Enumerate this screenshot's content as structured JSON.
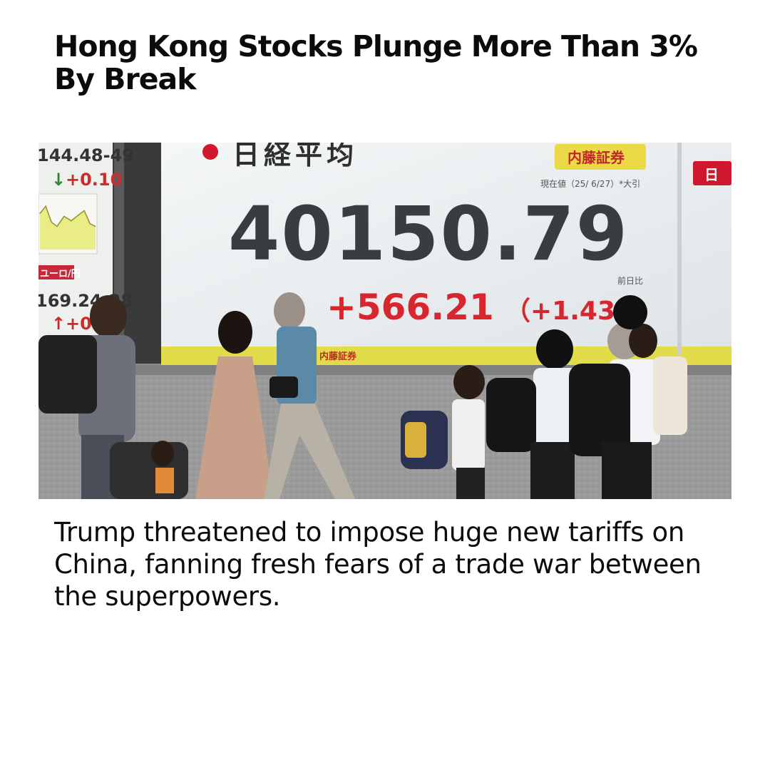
{
  "article": {
    "headline": "Hong Kong Stocks Plunge More Than 3% By Break",
    "caption": "Trump threatened to impose huge new tariffs on China, fanning fresh fears of a trade war between the superpowers."
  },
  "photo": {
    "board": {
      "index_name": "日経平均",
      "broker": "内藤証券",
      "date_note": "現在値（25/ 6/27）*大引",
      "value": "40150.79",
      "prev_label": "前日比",
      "change": "+566.21",
      "change_pct": "（+1.43%",
      "footer_broker": "内藤証券",
      "right_tag": "日"
    },
    "side_panel": {
      "top_value": "144.48-49",
      "top_change": "+0.10",
      "label": "ユーロ/円",
      "bottom_value": "169.24-28",
      "bottom_change": "+0.3"
    }
  }
}
